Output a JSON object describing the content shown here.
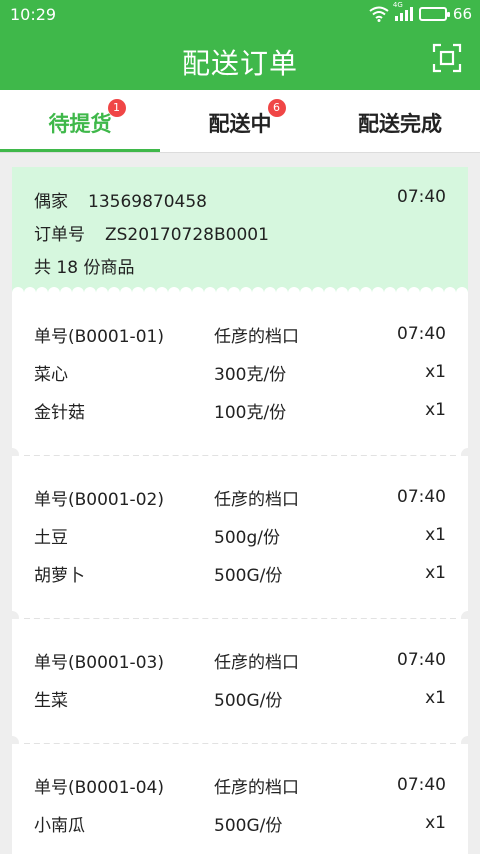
{
  "status_bar": {
    "time": "10:29",
    "network_tag": "4G",
    "battery": "66",
    "icons": [
      "wifi-icon",
      "signal-icon",
      "battery-icon"
    ]
  },
  "header": {
    "title": "配送订单",
    "scan_icon": "scan-icon"
  },
  "tabs": [
    {
      "label": "待提货",
      "badge": "1",
      "active": true
    },
    {
      "label": "配送中",
      "badge": "6",
      "active": false
    },
    {
      "label": "配送完成",
      "badge": "",
      "active": false
    }
  ],
  "order": {
    "customer": "偶家",
    "phone": "13569870458",
    "time": "07:40",
    "order_no_label": "订单号",
    "order_no": "ZS20170728B0001",
    "count_text": "共 18 份商品"
  },
  "stalls": [
    {
      "number": "单号(B0001-01)",
      "stall": "任彦的档口",
      "time": "07:40",
      "items": [
        {
          "name": "菜心",
          "spec": "300克/份",
          "qty": "x1"
        },
        {
          "name": "金针菇",
          "spec": "100克/份",
          "qty": "x1"
        }
      ]
    },
    {
      "number": "单号(B0001-02)",
      "stall": "任彦的档口",
      "time": "07:40",
      "items": [
        {
          "name": "土豆",
          "spec": "500g/份",
          "qty": "x1"
        },
        {
          "name": "胡萝卜",
          "spec": "500G/份",
          "qty": "x1"
        }
      ]
    },
    {
      "number": "单号(B0001-03)",
      "stall": "任彦的档口",
      "time": "07:40",
      "items": [
        {
          "name": "生菜",
          "spec": "500G/份",
          "qty": "x1"
        }
      ]
    },
    {
      "number": "单号(B0001-04)",
      "stall": "任彦的档口",
      "time": "07:40",
      "items": [
        {
          "name": "小南瓜",
          "spec": "500G/份",
          "qty": "x1"
        }
      ]
    }
  ],
  "colors": {
    "primary": "#3fb84a",
    "header_bg": "#d6f7de",
    "badge": "#f04646"
  }
}
